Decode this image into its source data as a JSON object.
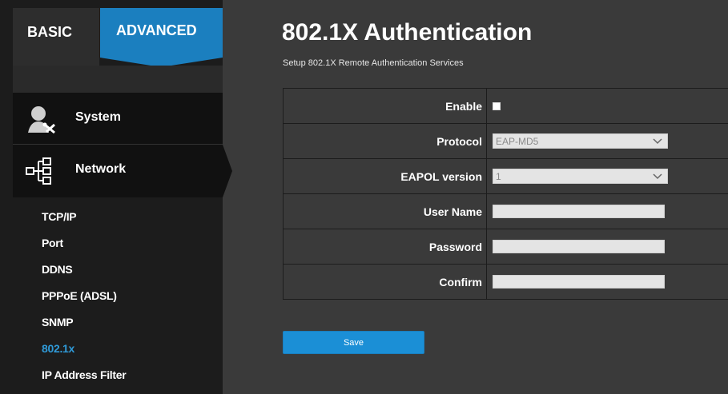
{
  "tabs": {
    "basic": "BASIC",
    "advanced": "ADVANCED"
  },
  "menu": {
    "system": "System",
    "network": "Network",
    "sub_items": [
      {
        "label": "TCP/IP"
      },
      {
        "label": "Port"
      },
      {
        "label": "DDNS"
      },
      {
        "label": "PPPoE (ADSL)"
      },
      {
        "label": "SNMP"
      },
      {
        "label": "802.1x"
      },
      {
        "label": "IP Address Filter"
      }
    ]
  },
  "page": {
    "title": "802.1X Authentication",
    "subtitle": "Setup 802.1X Remote Authentication Services"
  },
  "form": {
    "enable_label": "Enable",
    "protocol_label": "Protocol",
    "protocol_value": "EAP-MD5",
    "eapol_label": "EAPOL version",
    "eapol_value": "1",
    "username_label": "User Name",
    "password_label": "Password",
    "confirm_label": "Confirm"
  },
  "save_label": "Save",
  "colors": {
    "accent": "#1b7fbf",
    "active_sub": "#2f9ad8",
    "background": "#3a3a3a"
  }
}
